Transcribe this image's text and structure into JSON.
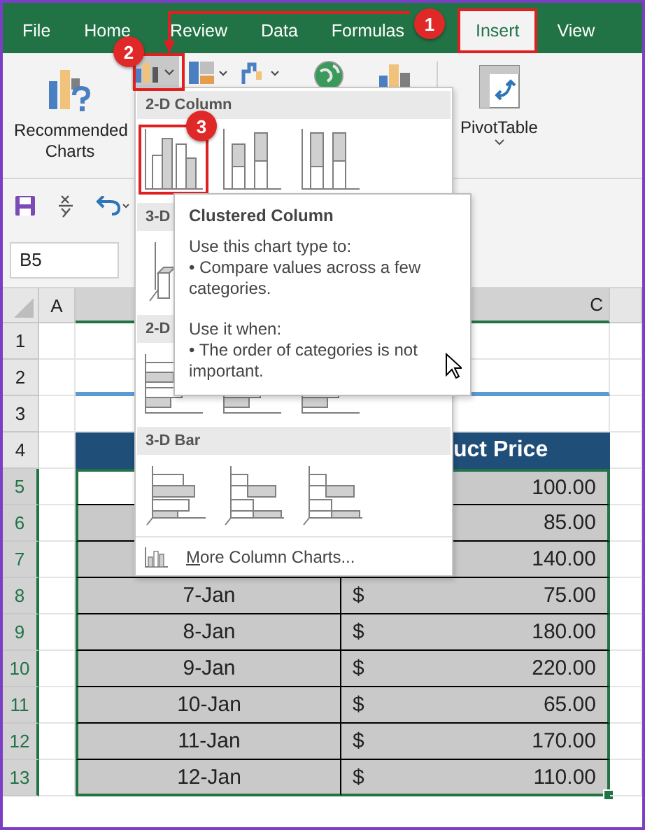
{
  "tabs": [
    {
      "label": "File",
      "selected": false
    },
    {
      "label": "Home",
      "selected": false
    },
    {
      "label": "Review",
      "selected": false
    },
    {
      "label": "Data",
      "selected": false
    },
    {
      "label": "Formulas",
      "selected": false
    },
    {
      "label": "Insert",
      "selected": true,
      "annotated": true
    },
    {
      "label": "View",
      "selected": false
    }
  ],
  "ribbon": {
    "recommended_charts": "Recommended Charts",
    "pivot_table": "PivotTable"
  },
  "name_box": "B5",
  "column_headers": [
    {
      "label": "A",
      "selected": false
    },
    {
      "label": "C",
      "selected": true
    }
  ],
  "row_numbers": [
    {
      "label": "1",
      "selected": false
    },
    {
      "label": "2",
      "selected": false
    },
    {
      "label": "3",
      "selected": false
    },
    {
      "label": "4",
      "selected": false
    },
    {
      "label": "5",
      "selected": true
    },
    {
      "label": "6",
      "selected": true
    },
    {
      "label": "7",
      "selected": true
    },
    {
      "label": "8",
      "selected": true
    },
    {
      "label": "9",
      "selected": true
    },
    {
      "label": "10",
      "selected": true
    },
    {
      "label": "11",
      "selected": true
    },
    {
      "label": "12",
      "selected": true
    },
    {
      "label": "13",
      "selected": true
    }
  ],
  "table": {
    "price_header": "uct Price",
    "rows": [
      {
        "active": true,
        "price": "100.00"
      },
      {
        "active": false,
        "price": "85.00"
      },
      {
        "active": false,
        "price": "140.00"
      },
      {
        "active": false,
        "date": "7-Jan",
        "currency": "$",
        "price": "75.00"
      },
      {
        "active": false,
        "date": "8-Jan",
        "currency": "$",
        "price": "180.00"
      },
      {
        "active": false,
        "date": "9-Jan",
        "currency": "$",
        "price": "220.00"
      },
      {
        "active": false,
        "date": "10-Jan",
        "currency": "$",
        "price": "65.00"
      },
      {
        "active": false,
        "date": "11-Jan",
        "currency": "$",
        "price": "170.00"
      },
      {
        "active": false,
        "date": "12-Jan",
        "currency": "$",
        "price": "110.00"
      }
    ]
  },
  "gallery": {
    "sections": [
      {
        "title": "2-D Column",
        "kind": "column",
        "items": [
          {
            "selected": true
          },
          {
            "selected": false
          },
          {
            "selected": false
          }
        ]
      },
      {
        "title": "3-D",
        "kind": "column3d",
        "items": [
          {
            "selected": false
          }
        ]
      },
      {
        "title": "2-D",
        "kind": "bar",
        "items": [
          {
            "selected": false
          },
          {
            "selected": false
          },
          {
            "selected": false
          }
        ]
      },
      {
        "title": "3-D Bar",
        "kind": "bar3d",
        "items": [
          {
            "selected": false
          },
          {
            "selected": false
          },
          {
            "selected": false
          }
        ]
      }
    ],
    "more_link": "More Column Charts..."
  },
  "tooltip": {
    "title": "Clustered Column",
    "groups": [
      [
        "Use this chart type to:",
        "• Compare values across a few categories."
      ],
      [
        "Use it when:",
        "• The order of categories is not important."
      ]
    ]
  },
  "callouts": [
    {
      "number": "1"
    },
    {
      "number": "2"
    },
    {
      "number": "3"
    }
  ]
}
